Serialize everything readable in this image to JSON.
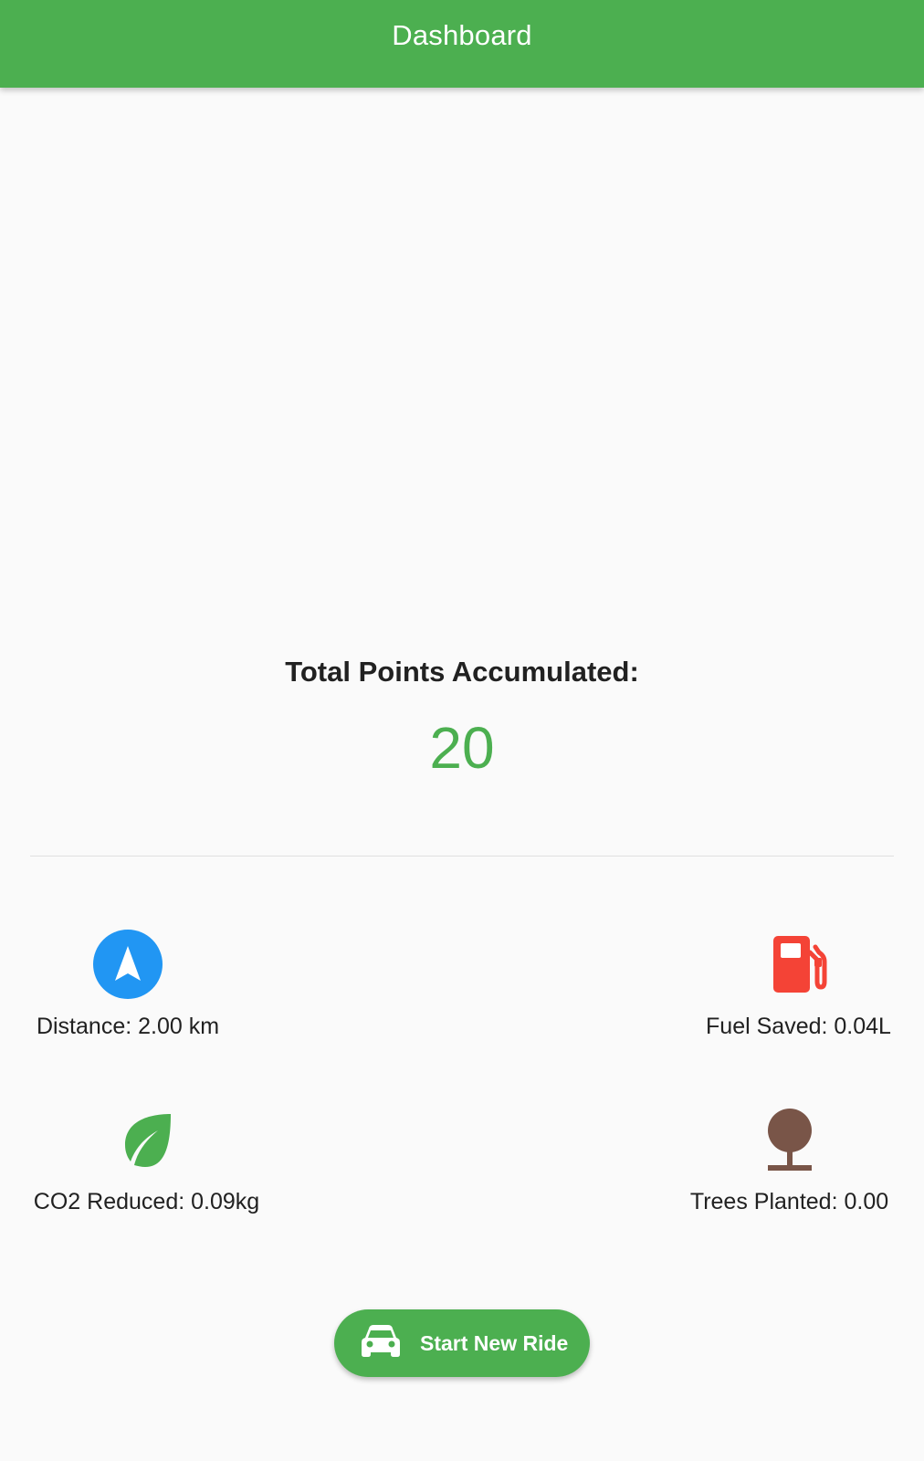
{
  "app_bar": {
    "title": "Dashboard",
    "color": "#4caf50"
  },
  "points": {
    "label": "Total Points Accumulated:",
    "value": "20",
    "color": "#4caf50"
  },
  "stats": {
    "distance": {
      "text": "Distance: 2.00 km",
      "icon": "navigation-icon",
      "color": "#2196f3"
    },
    "fuel": {
      "text": "Fuel Saved: 0.04L",
      "icon": "gas-station-icon",
      "color": "#f44336"
    },
    "co2": {
      "text": "CO2 Reduced: 0.09kg",
      "icon": "eco-leaf-icon",
      "color": "#4caf50"
    },
    "trees": {
      "text": "Trees Planted: 0.00",
      "icon": "tree-icon",
      "color": "#795548"
    }
  },
  "start_button": {
    "label": "Start New Ride",
    "icon": "car-icon"
  }
}
